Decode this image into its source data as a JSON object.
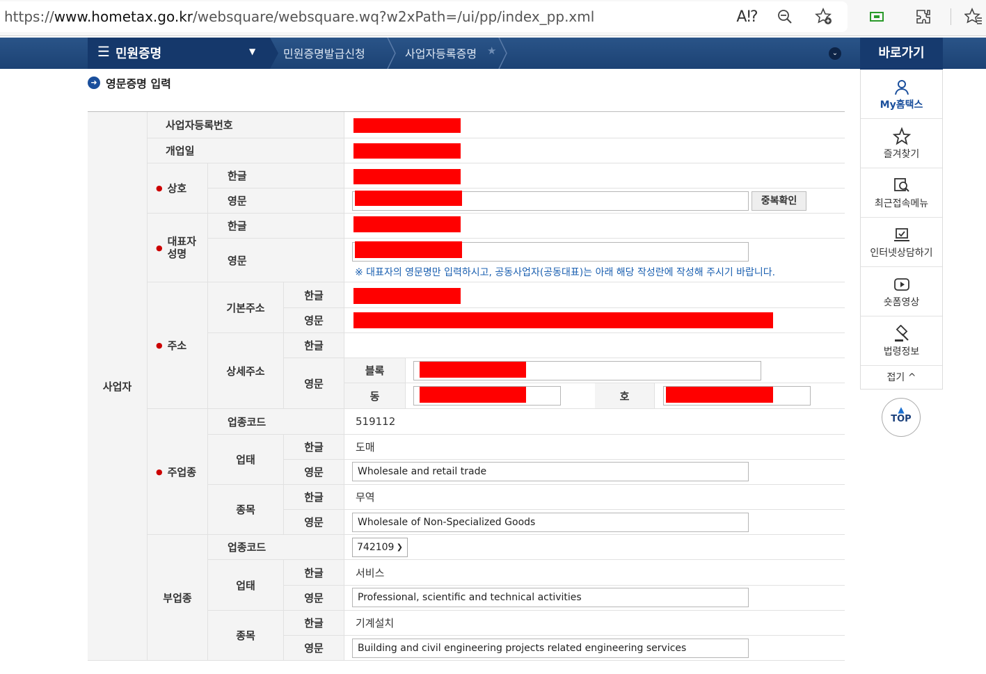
{
  "browser": {
    "url_prefix": "https://",
    "url_domain": "www.hometax.go.kr",
    "url_path": "/websquare/websquare.wq?w2xPath=/ui/pp/index_pp.xml"
  },
  "nav": {
    "menu_label": "민원증명",
    "crumb1": "민원증명발급신청",
    "crumb2": "사업자등록증명",
    "quick_label": "바로가기"
  },
  "section": {
    "title": "영문증명 입력"
  },
  "form": {
    "group": "사업자",
    "labels": {
      "biz_no": "사업자등록번호",
      "open_date": "개업일",
      "trade_name": "상호",
      "rep_name": "대표자\n성명",
      "address": "주소",
      "basic_addr": "기본주소",
      "detail_addr": "상세주소",
      "main_industry": "주업종",
      "sub_industry": "부업종",
      "industry_code": "업종코드",
      "biz_type": "업태",
      "biz_item": "종목",
      "korean": "한글",
      "english": "영문",
      "block": "블록",
      "dong": "동",
      "ho": "호"
    },
    "dup_check_button": "중복확인",
    "rep_note": "※ 대표자의 영문명만 입력하시고, 공동사업자(공동대표)는 아래 해당 작성란에 작성해 주시기 바랍니다.",
    "main": {
      "code": "519112",
      "type_kr": "도매",
      "type_en": "Wholesale and retail trade",
      "item_kr": "무역",
      "item_en": "Wholesale of Non-Specialized Goods"
    },
    "sub": {
      "code": "742109",
      "type_kr": "서비스",
      "type_en": "Professional, scientific and technical activities",
      "item_kr": "기계설치",
      "item_en": "Building and civil engineering projects related engineering services"
    }
  },
  "quick": {
    "items": [
      "My홈택스",
      "즐겨찾기",
      "최근접속메뉴",
      "인터넷상담하기",
      "숏폼영상",
      "법령정보"
    ],
    "fold": "접기 ^",
    "top": "TOP"
  }
}
